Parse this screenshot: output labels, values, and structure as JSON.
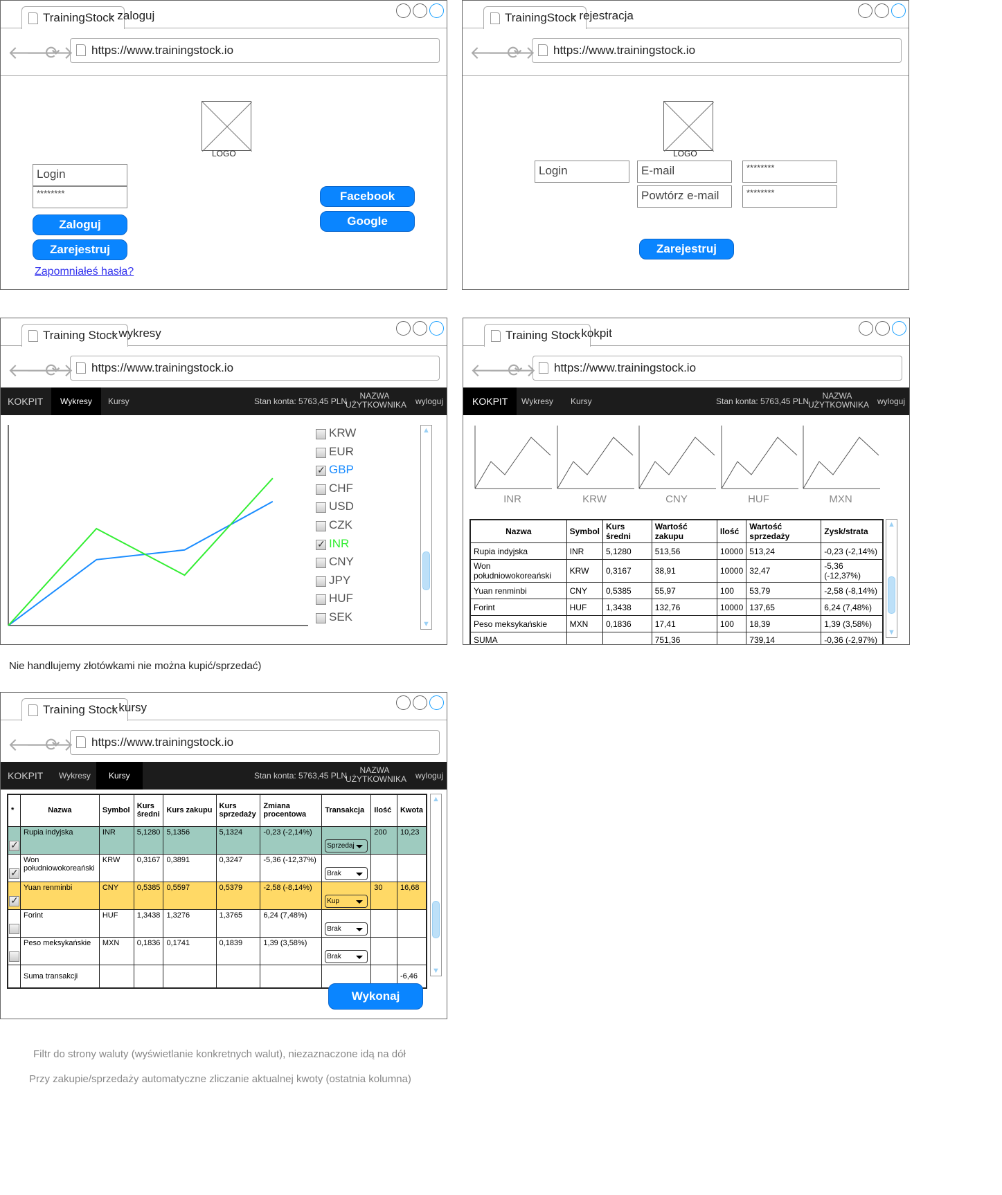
{
  "common": {
    "url": "https://www.trainingstock.io",
    "tab_sep": "-"
  },
  "login": {
    "tab_title": "TrainingStock",
    "tab_page": "zaloguj",
    "logo": "LOGO",
    "login_placeholder": "Login",
    "password_mask": "********",
    "login_button": "Zaloguj",
    "register_button": "Zarejestruj",
    "forgot_link": "Zapomniałeś hasła?",
    "facebook_button": "Facebook",
    "google_button": "Google"
  },
  "register": {
    "tab_title": "TrainingStock",
    "tab_page": "rejestracja",
    "logo": "LOGO",
    "login_placeholder": "Login",
    "email_placeholder": "E-mail",
    "repeat_email_placeholder": "Powtórz e-mail",
    "password_mask": "********",
    "password_repeat_mask": "********",
    "register_button": "Zarejestruj"
  },
  "nav": {
    "kokpit": "KOKPIT",
    "wykresy": "Wykresy",
    "kursy": "Kursy",
    "balance": "Stan konta: 5763,45 PLN",
    "user_line1": "NAZWA",
    "user_line2": "UŻYTKOWNIKA",
    "logout": "wyloguj"
  },
  "charts": {
    "tab_title": "Training Stock",
    "tab_page": "wykresy",
    "currencies": [
      {
        "code": "KRW",
        "checked": false,
        "color": "#555555"
      },
      {
        "code": "EUR",
        "checked": false,
        "color": "#555555"
      },
      {
        "code": "GBP",
        "checked": true,
        "color": "#1a8cff"
      },
      {
        "code": "CHF",
        "checked": false,
        "color": "#555555"
      },
      {
        "code": "USD",
        "checked": false,
        "color": "#555555"
      },
      {
        "code": "CZK",
        "checked": false,
        "color": "#555555"
      },
      {
        "code": "INR",
        "checked": true,
        "color": "#33ee33"
      },
      {
        "code": "CNY",
        "checked": false,
        "color": "#555555"
      },
      {
        "code": "JPY",
        "checked": false,
        "color": "#555555"
      },
      {
        "code": "HUF",
        "checked": false,
        "color": "#555555"
      },
      {
        "code": "SEK",
        "checked": false,
        "color": "#555555"
      }
    ]
  },
  "chart_data": {
    "type": "line",
    "x": [
      0,
      1,
      2,
      3
    ],
    "series": [
      {
        "name": "GBP",
        "color": "#1a8cff",
        "values": [
          0,
          34,
          39,
          64
        ]
      },
      {
        "name": "INR",
        "color": "#33ee33",
        "values": [
          0,
          50,
          26,
          76
        ]
      }
    ],
    "ylim": [
      0,
      100
    ],
    "xlim": [
      0,
      3.3
    ]
  },
  "dashboard": {
    "tab_title": "Training Stock",
    "tab_page": "kokpit",
    "sparklines": [
      "INR",
      "KRW",
      "CNY",
      "HUF",
      "MXN"
    ],
    "table": {
      "headers": [
        "Nazwa",
        "Symbol",
        "Kurs średni",
        "Wartość zakupu",
        "Ilość",
        "Wartość sprzedaży",
        "Zysk/strata"
      ],
      "rows": [
        [
          "Rupia indyjska",
          "INR",
          "5,1280",
          "513,56",
          "10000",
          "513,24",
          "-0,23 (-2,14%)"
        ],
        [
          "Won południowokoreański",
          "KRW",
          "0,3167",
          "38,91",
          "10000",
          "32,47",
          "-5,36 (-12,37%)"
        ],
        [
          "Yuan renminbi",
          "CNY",
          "0,5385",
          "55,97",
          "100",
          "53,79",
          "-2,58 (-8,14%)"
        ],
        [
          "Forint",
          "HUF",
          "1,3438",
          "132,76",
          "10000",
          "137,65",
          "6,24 (7,48%)"
        ],
        [
          "Peso meksykańskie",
          "MXN",
          "0,1836",
          "17,41",
          "100",
          "18,39",
          "1,39 (3,58%)"
        ],
        [
          "SUMA",
          "",
          "",
          "751,36",
          "",
          "739,14",
          "-0,36 (-2,97%)"
        ]
      ]
    }
  },
  "rates": {
    "tab_title": "Training Stock",
    "tab_page": "kursy",
    "headers": [
      "*",
      "Nazwa",
      "Symbol",
      "Kurs średni",
      "Kurs zakupu",
      "Kurs sprzedaży",
      "Zmiana procentowa",
      "Transakcja",
      "Ilość",
      "Kwota"
    ],
    "rows": [
      {
        "name": "Rupia indyjska",
        "symbol": "INR",
        "avg": "5,1280",
        "buy": "5,1356",
        "sell": "5,1324",
        "change": "-0,23 (-2,14%)",
        "action": "Sprzedaj",
        "qty": "200",
        "amount": "10,23",
        "checked": true,
        "bg": "#9ecbbf"
      },
      {
        "name": "Won południowokoreański",
        "symbol": "KRW",
        "avg": "0,3167",
        "buy": "0,3891",
        "sell": "0,3247",
        "change": "-5,36 (-12,37%)",
        "action": "Brak",
        "qty": "",
        "amount": "",
        "checked": true,
        "bg": "#ffffff"
      },
      {
        "name": "Yuan renminbi",
        "symbol": "CNY",
        "avg": "0,5385",
        "buy": "0,5597",
        "sell": "0,5379",
        "change": "-2,58 (-8,14%)",
        "action": "Kup",
        "qty": "30",
        "amount": "16,68",
        "checked": true,
        "bg": "#ffd966"
      },
      {
        "name": "Forint",
        "symbol": "HUF",
        "avg": "1,3438",
        "buy": "1,3276",
        "sell": "1,3765",
        "change": "6,24 (7,48%)",
        "action": "Brak",
        "qty": "",
        "amount": "",
        "checked": false,
        "bg": "#ffffff"
      },
      {
        "name": "Peso meksykańskie",
        "symbol": "MXN",
        "avg": "0,1836",
        "buy": "0,1741",
        "sell": "0,1839",
        "change": "1,39 (3,58%)",
        "action": "Brak",
        "qty": "",
        "amount": "",
        "checked": false,
        "bg": "#ffffff"
      }
    ],
    "sum_label": "Suma transakcji",
    "sum_amount": "-6,46",
    "execute_button": "Wykonaj"
  },
  "notes": {
    "no_pln": "Nie handlujemy złotówkami nie można kupić/sprzedać)",
    "filter": "Filtr do strony waluty (wyświetlanie konkretnych walut), niezaznaczone idą na dół",
    "auto_sum": "Przy zakupie/sprzedaży automatyczne zliczanie aktualnej kwoty (ostatnia kolumna)"
  }
}
